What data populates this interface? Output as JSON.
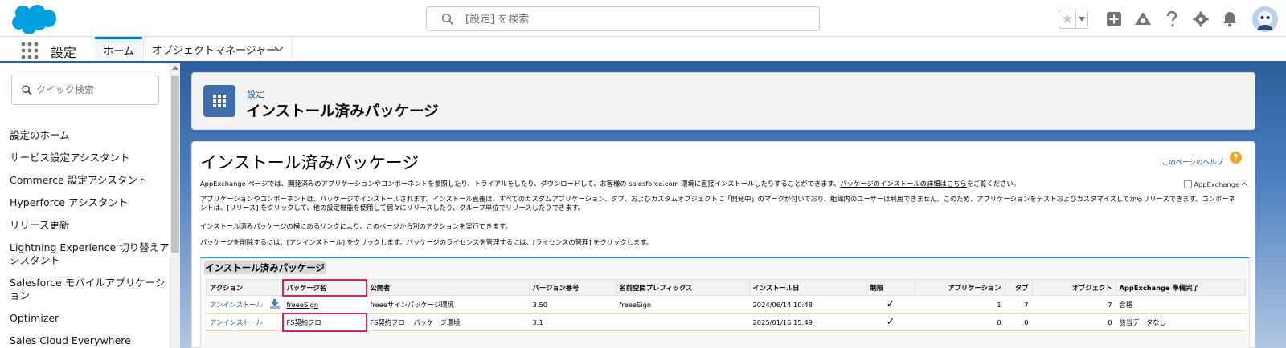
{
  "global_header": {
    "search_placeholder": "[設定] を検索"
  },
  "app_nav": {
    "app_name": "設定",
    "tabs": [
      {
        "label": "ホーム"
      },
      {
        "label": "オブジェクトマネージャー"
      }
    ]
  },
  "sidebar": {
    "quick_find_placeholder": "クイック検索",
    "items": [
      {
        "label": "設定のホーム"
      },
      {
        "label": "サービス設定アシスタント"
      },
      {
        "label": "Commerce 設定アシスタント"
      },
      {
        "label": "Hyperforce アシスタント"
      },
      {
        "label": "リリース更新"
      },
      {
        "label": "Lightning Experience 切り替えアシスタント"
      },
      {
        "label": "Salesforce モバイルアプリケーション"
      },
      {
        "label": "Optimizer"
      },
      {
        "label": "Sales Cloud Everywhere"
      }
    ]
  },
  "page_header": {
    "breadcrumb": "設定",
    "title": "インストール済みパッケージ"
  },
  "content": {
    "title": "インストール済みパッケージ",
    "help_link": "このページのヘルプ",
    "appexchange_alt": "AppExchange へ",
    "para1_text": "AppExchange ページでは、開発済みのアプリケーションやコンポーネントを参照したり、トライアルをしたり、ダウンロードして、お客様の salesforce.com 環境に直接インストールしたりすることができます。",
    "para1_link": "パッケージのインストールの詳細はこちら",
    "para1_tail": "をご覧ください。",
    "para2": "アプリケーションやコンポーネントは、パッケージでインストールされます。インストール直後は、すべてのカスタムアプリケーション、タブ、およびカスタムオブジェクトに「開発中」のマークが付いており、組織内のユーザーは利用できません。このため、アプリケーションをテストおよびカスタマイズしてからリリースできます。コンポーネントは、[リリース] をクリックして、他の設定機能を使用して個々にリリースしたり、グループ単位でリリースしたりできます。",
    "para3": "インストール済みパッケージの横にあるリンクにより、このページから別のアクションを実行できます。",
    "para4": "パッケージを削除するには、[アンインストール] をクリックします。パッケージのライセンスを管理するには、[ライセンスの管理] をクリックします。"
  },
  "installed_packages": {
    "section_title": "インストール済みパッケージ",
    "columns": [
      "アクション",
      "パッケージ名",
      "公開者",
      "バージョン番号",
      "名前空間プレフィックス",
      "インストール日",
      "制限",
      "アプリケーション",
      "タブ",
      "オブジェクト",
      "AppExchange 準備完了"
    ],
    "rows": [
      {
        "action": "アンインストール",
        "name": "freeeSign",
        "publisher": "freeeサインパッケージ環境",
        "version": "3.50",
        "namespace": "freeeSign",
        "installed": "2024/06/14 10:48",
        "limit": "✓",
        "apps": "1",
        "tabs": "7",
        "objects": "7",
        "ready": "合格"
      },
      {
        "action": "アンインストール",
        "name": "FS契約フロー",
        "publisher": "FS契約フロー パッケージ環境",
        "version": "3.1",
        "namespace": "",
        "installed": "2025/01/16 15:49",
        "limit": "✓",
        "apps": "0",
        "tabs": "0",
        "objects": "0",
        "ready": "該当データなし"
      }
    ]
  },
  "colors": {
    "brand_blue": "#00a1e0",
    "header_band": "#2e5e9e",
    "link": "#015ba7",
    "highlight": "#e11d5c"
  }
}
